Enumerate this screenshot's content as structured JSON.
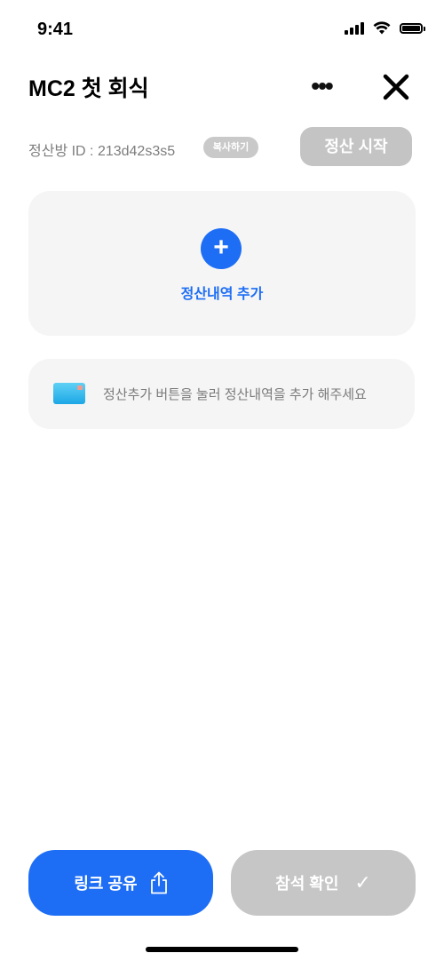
{
  "status_bar": {
    "time": "9:41"
  },
  "header": {
    "title": "MC2 첫 회식",
    "more_icon": "more-icon",
    "close_icon": "close-icon"
  },
  "room": {
    "id_text": "정산방 ID : 213d42s3s5",
    "copy_label": "복사하기",
    "start_label": "정산 시작"
  },
  "add_card": {
    "plus": "+",
    "label": "정산내역 추가"
  },
  "hint": {
    "icon": "card-icon",
    "text": "정산추가 버튼을 눌러 정산내역을 추가 해주세요"
  },
  "bottom": {
    "share_label": "링크 공유",
    "share_icon": "share-icon",
    "confirm_label": "참석 확인",
    "confirm_icon": "✓"
  },
  "colors": {
    "accent": "#1d6ef5",
    "disabled": "#c4c4c4",
    "card_bg": "#f5f5f5"
  }
}
